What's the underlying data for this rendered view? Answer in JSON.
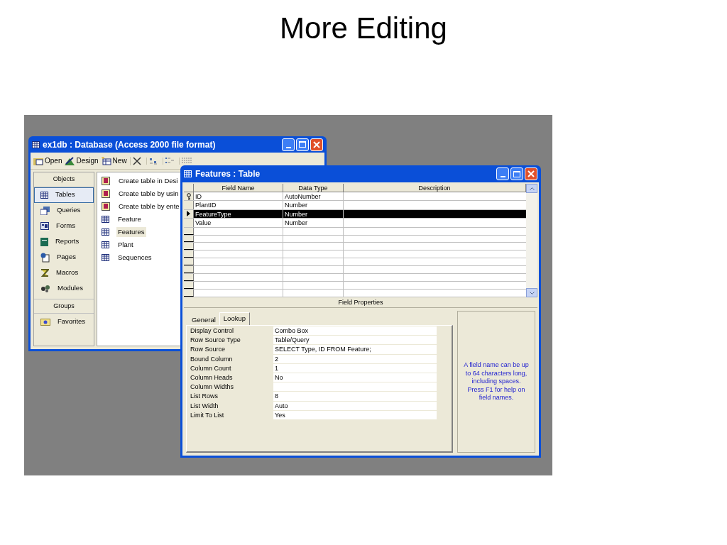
{
  "slide_title": "More Editing",
  "database_window": {
    "title": "ex1db : Database (Access 2000 file format)",
    "toolbar": [
      {
        "kind": "text",
        "label": "Open"
      },
      {
        "kind": "text",
        "label": "Design"
      },
      {
        "kind": "text",
        "label": "New"
      }
    ],
    "objects_header": "Objects",
    "objects": [
      {
        "label": "Tables",
        "selected": true
      },
      {
        "label": "Queries",
        "selected": false
      },
      {
        "label": "Forms",
        "selected": false
      },
      {
        "label": "Reports",
        "selected": false
      },
      {
        "label": "Pages",
        "selected": false
      },
      {
        "label": "Macros",
        "selected": false
      },
      {
        "label": "Modules",
        "selected": false
      }
    ],
    "groups_header": "Groups",
    "groups": [
      {
        "label": "Favorites",
        "selected": false
      }
    ],
    "items": [
      {
        "kind": "wizard",
        "label": "Create table in Desi",
        "selected": false
      },
      {
        "kind": "wizard",
        "label": "Create table by usin",
        "selected": false
      },
      {
        "kind": "wizard",
        "label": "Create table by ente",
        "selected": false
      },
      {
        "kind": "table",
        "label": "Feature",
        "selected": false
      },
      {
        "kind": "table",
        "label": "Features",
        "selected": true
      },
      {
        "kind": "table",
        "label": "Plant",
        "selected": false
      },
      {
        "kind": "table",
        "label": "Sequences",
        "selected": false
      }
    ]
  },
  "table_window": {
    "title": "Features : Table",
    "columns": [
      "Field Name",
      "Data Type",
      "Description"
    ],
    "rows": [
      {
        "kind": "key",
        "field_name": "ID",
        "data_type": "AutoNumber",
        "selected": false
      },
      {
        "kind": "plain",
        "field_name": "PlantID",
        "data_type": "Number",
        "selected": false
      },
      {
        "kind": "current",
        "field_name": "FeatureType",
        "data_type": "Number",
        "selected": true
      },
      {
        "kind": "plain",
        "field_name": "Value",
        "data_type": "Number",
        "selected": false
      }
    ],
    "field_properties_label": "Field Properties",
    "tabs": [
      {
        "label": "General",
        "selected": false
      },
      {
        "label": "Lookup",
        "selected": true
      }
    ],
    "properties": [
      {
        "name": "Display Control",
        "value": "Combo Box"
      },
      {
        "name": "Row Source Type",
        "value": "Table/Query"
      },
      {
        "name": "Row Source",
        "value": "SELECT Type, ID FROM Feature;"
      },
      {
        "name": "Bound Column",
        "value": "2"
      },
      {
        "name": "Column Count",
        "value": "1"
      },
      {
        "name": "Column Heads",
        "value": "No"
      },
      {
        "name": "Column Widths"
      },
      {
        "name": "List Rows",
        "value": "8"
      },
      {
        "name": "List Width",
        "value": "Auto"
      },
      {
        "name": "Limit To List",
        "value": "Yes"
      }
    ],
    "help_text": "A field name can be up to 64 characters long, including spaces.  Press F1 for help on field names."
  }
}
